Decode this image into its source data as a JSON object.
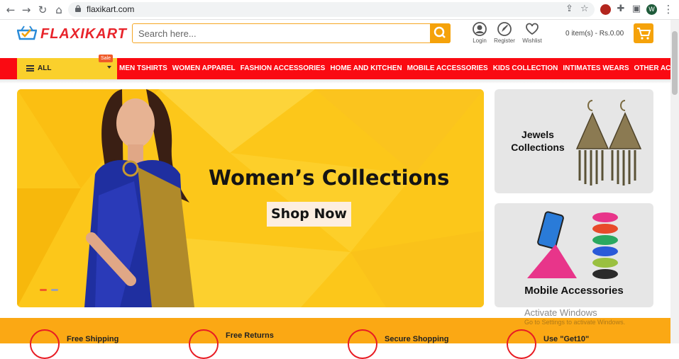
{
  "browser": {
    "url": "flaxikart.com",
    "profile_initial": "W"
  },
  "header": {
    "logo_text": "FLAXIKART",
    "search_placeholder": "Search here...",
    "login_label": "Login",
    "register_label": "Register",
    "wishlist_label": "Wishlist",
    "cart_summary": "0 item(s) - Rs.0.00"
  },
  "nav": {
    "all_label": "ALL",
    "sale_badge": "Sale",
    "categories": [
      "MEN TSHIRTS",
      "WOMEN APPAREL",
      "FASHION ACCESSORIES",
      "HOME AND KITCHEN",
      "MOBILE ACCESSORIES",
      "KIDS COLLECTION",
      "INTIMATES WEARS",
      "OTHER ACCESSORIES"
    ]
  },
  "hero": {
    "title": "Women’s Collections",
    "cta": "Shop Now"
  },
  "side_banners": {
    "jewels": "Jewels Collections",
    "mobile": "Mobile Accessories"
  },
  "features": [
    {
      "label": "Free Shipping"
    },
    {
      "label": "Free Returns"
    },
    {
      "label": "Secure Shopping"
    },
    {
      "label": "Use \"Get10\""
    }
  ],
  "watermark": {
    "title": "Activate Windows",
    "subtitle": "Go to Settings to activate Windows."
  },
  "colors": {
    "brand_red": "#fa0a12",
    "accent_orange": "#f5a20a",
    "nav_yellow": "#fad02c"
  }
}
